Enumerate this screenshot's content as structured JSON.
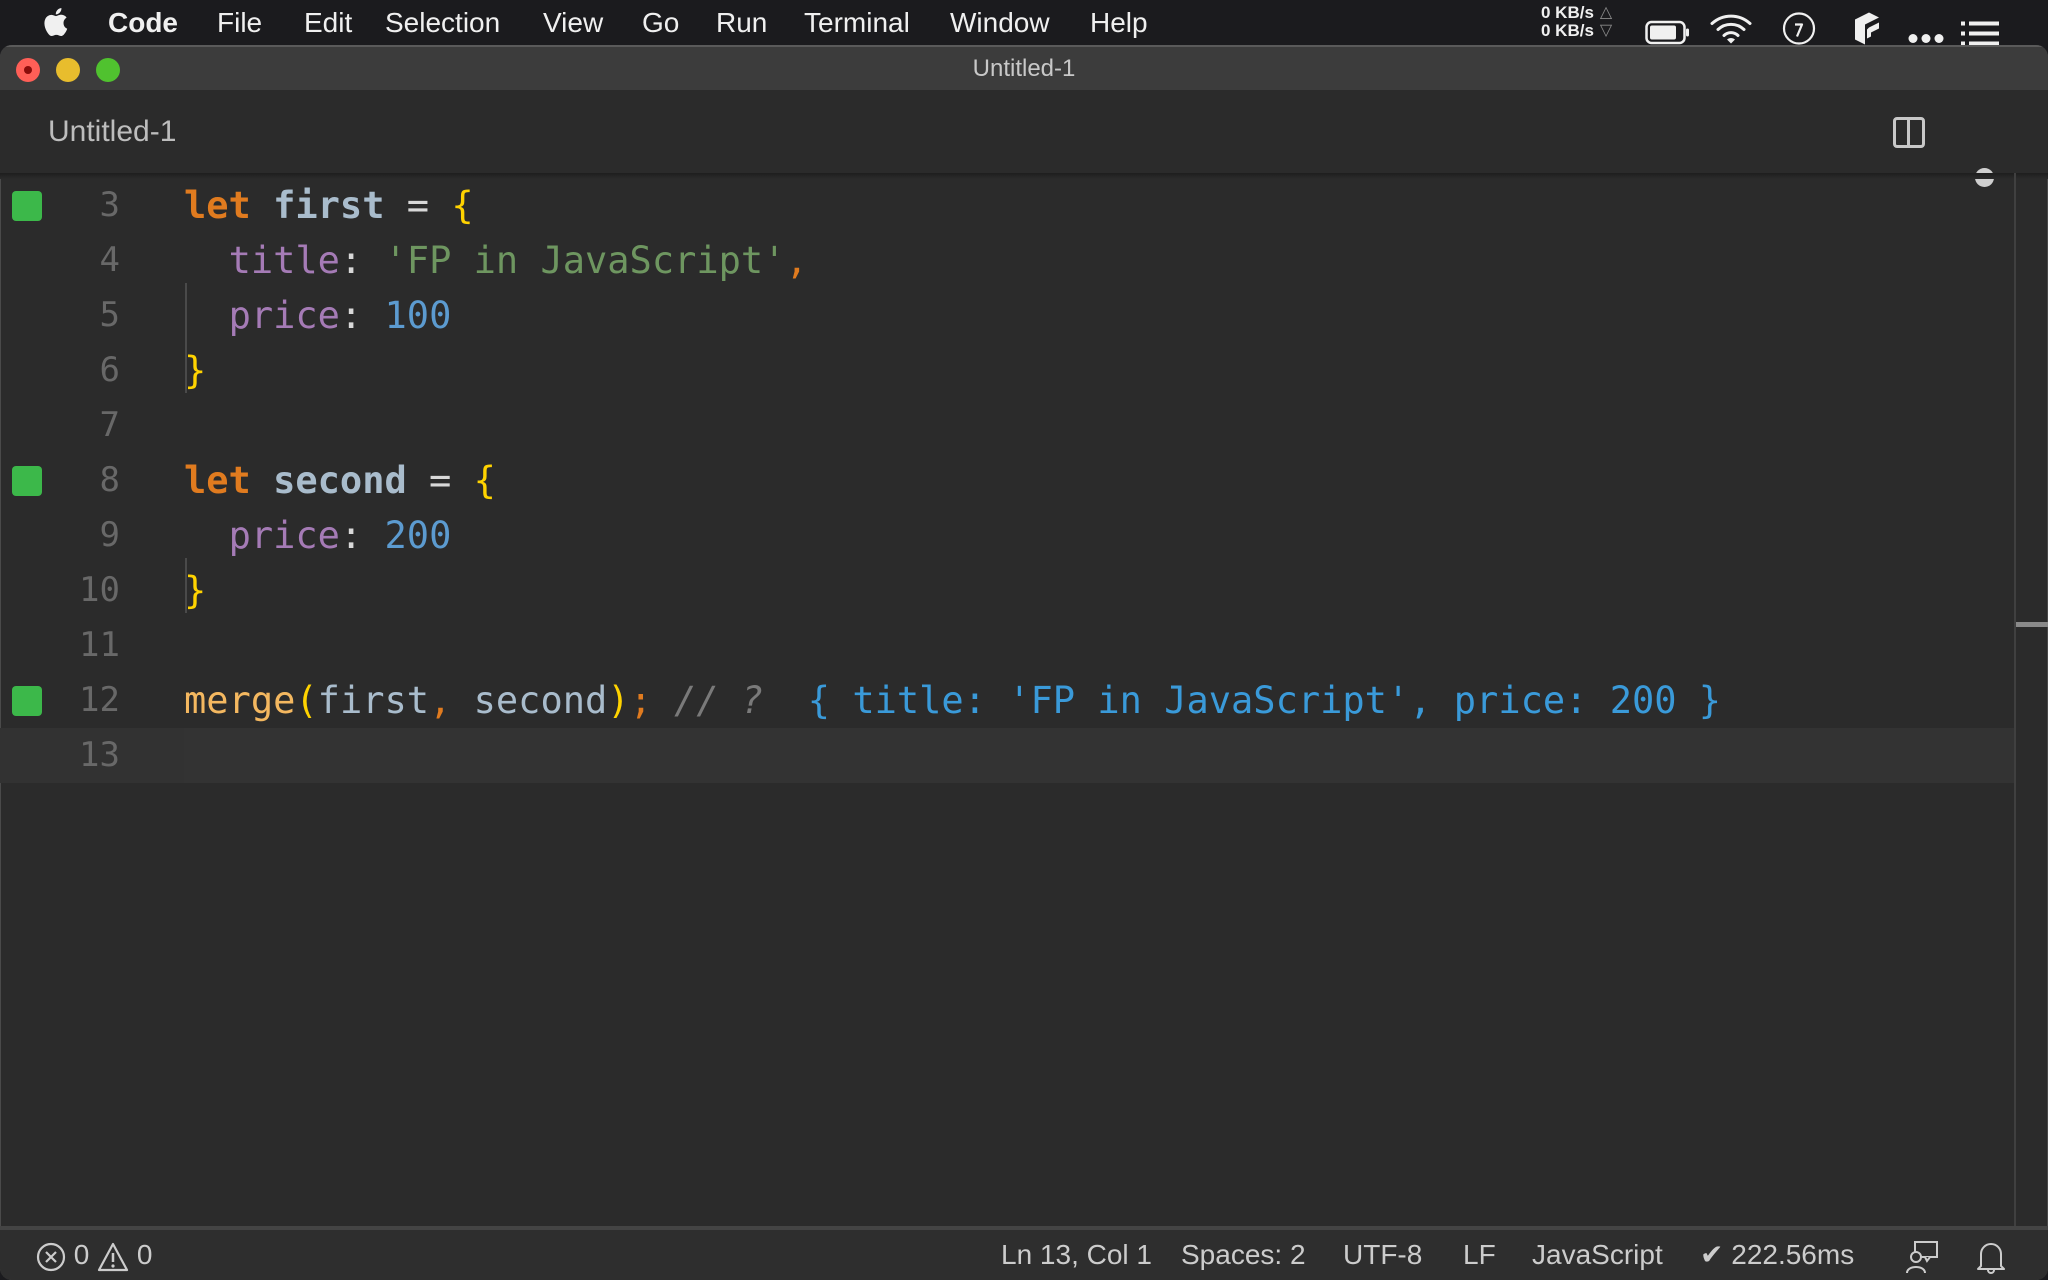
{
  "menubar": {
    "apple_icon": "apple-logo-icon",
    "app_name": "Code",
    "items": [
      "File",
      "Edit",
      "Selection",
      "View",
      "Go",
      "Run",
      "Terminal",
      "Window",
      "Help"
    ],
    "network": {
      "upload": "0 KB/s",
      "download": "0 KB/s",
      "upload_arrow": "△",
      "download_arrow": "▽"
    },
    "tray_icons": [
      "battery-icon",
      "wifi-icon",
      "clock-icon",
      "box-app-icon",
      "more-dots-icon",
      "list-menu-icon"
    ]
  },
  "window": {
    "title": "Untitled-1",
    "traffic_lights": {
      "close": "#ff5f57",
      "minimize": "#e8bd2d",
      "maximize": "#50c22f"
    }
  },
  "tab": {
    "label": "Untitled-1",
    "split_editor_icon": "split-editor-icon",
    "unsaved_indicator": "dirty-dot-icon"
  },
  "editor": {
    "lines": [
      {
        "number": "3",
        "marker": true,
        "tokens": [
          {
            "t": "let",
            "c": "k"
          },
          {
            "t": " ",
            "c": "op"
          },
          {
            "t": "first",
            "c": "id"
          },
          {
            "t": " = ",
            "c": "op"
          },
          {
            "t": "{",
            "c": "br"
          }
        ]
      },
      {
        "number": "4",
        "marker": false,
        "tokens": [
          {
            "t": "  ",
            "c": "op"
          },
          {
            "t": "title",
            "c": "prop"
          },
          {
            "t": ": ",
            "c": "op"
          },
          {
            "t": "'FP in JavaScript'",
            "c": "str"
          },
          {
            "t": ",",
            "c": "pun"
          }
        ]
      },
      {
        "number": "5",
        "marker": false,
        "tokens": [
          {
            "t": "  ",
            "c": "op"
          },
          {
            "t": "price",
            "c": "prop"
          },
          {
            "t": ": ",
            "c": "op"
          },
          {
            "t": "100",
            "c": "num"
          }
        ]
      },
      {
        "number": "6",
        "marker": false,
        "tokens": [
          {
            "t": "}",
            "c": "br"
          }
        ]
      },
      {
        "number": "7",
        "marker": false,
        "tokens": []
      },
      {
        "number": "8",
        "marker": true,
        "tokens": [
          {
            "t": "let",
            "c": "k"
          },
          {
            "t": " ",
            "c": "op"
          },
          {
            "t": "second",
            "c": "id"
          },
          {
            "t": " = ",
            "c": "op"
          },
          {
            "t": "{",
            "c": "br"
          }
        ]
      },
      {
        "number": "9",
        "marker": false,
        "tokens": [
          {
            "t": "  ",
            "c": "op"
          },
          {
            "t": "price",
            "c": "prop"
          },
          {
            "t": ": ",
            "c": "op"
          },
          {
            "t": "200",
            "c": "num"
          }
        ]
      },
      {
        "number": "10",
        "marker": false,
        "tokens": [
          {
            "t": "}",
            "c": "br"
          }
        ]
      },
      {
        "number": "11",
        "marker": false,
        "tokens": []
      },
      {
        "number": "12",
        "marker": true,
        "tokens": [
          {
            "t": "merge",
            "c": "fn"
          },
          {
            "t": "(",
            "c": "br"
          },
          {
            "t": "first",
            "c": "idn"
          },
          {
            "t": ",",
            "c": "pun"
          },
          {
            "t": " second",
            "c": "idn"
          },
          {
            "t": ")",
            "c": "br"
          },
          {
            "t": ";",
            "c": "pun"
          },
          {
            "t": " // ? ",
            "c": "cm"
          },
          {
            "t": " { title: 'FP in JavaScript', price: 200 }",
            "c": "res"
          }
        ]
      },
      {
        "number": "13",
        "marker": false,
        "current": true,
        "tokens": []
      }
    ],
    "marker_color": "#3cb84a"
  },
  "statusbar": {
    "errors": "0",
    "warnings": "0",
    "cursor_position": "Ln 13, Col 1",
    "indentation": "Spaces: 2",
    "encoding": "UTF-8",
    "line_ending": "LF",
    "language": "JavaScript",
    "quokka_timing": "✔ 222.56ms"
  }
}
